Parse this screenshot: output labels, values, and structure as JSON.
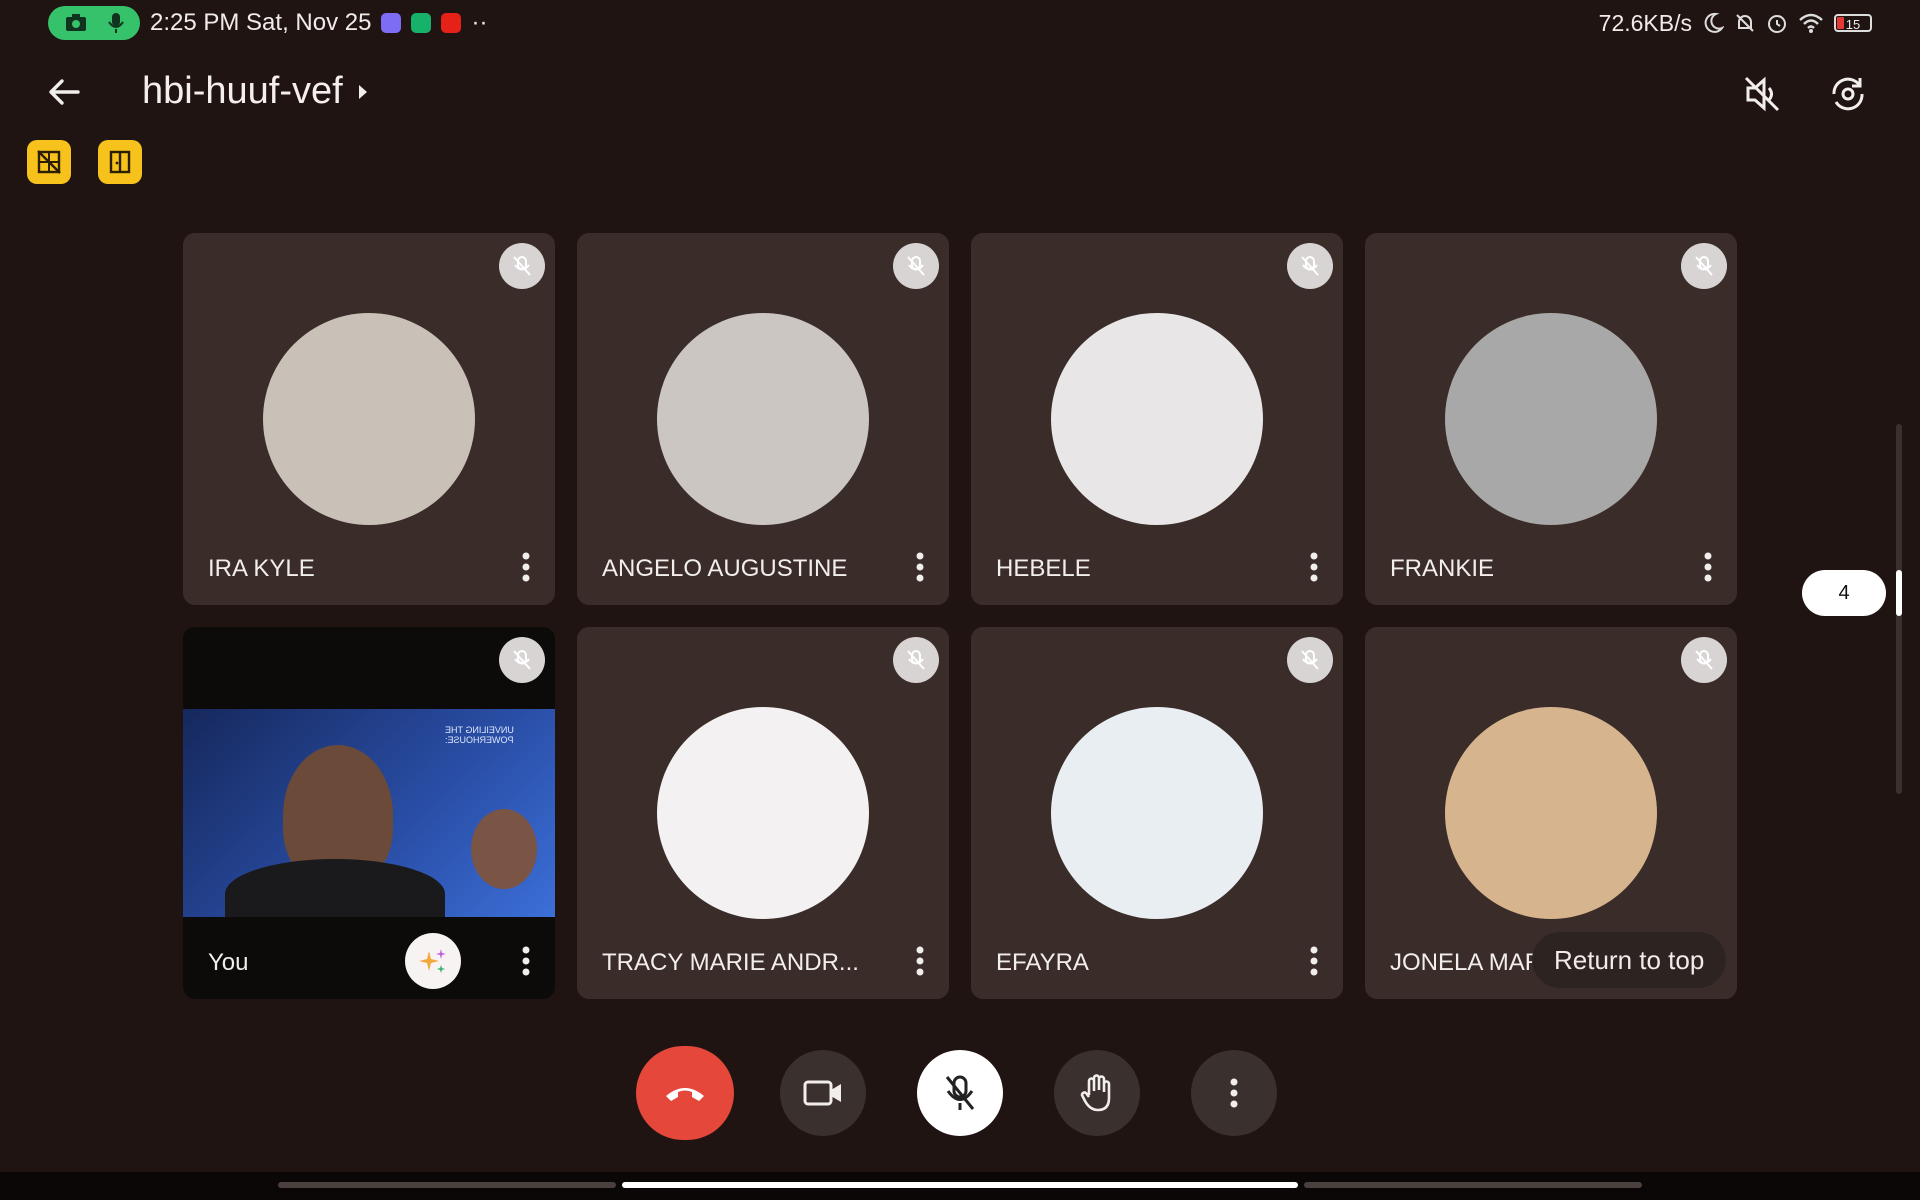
{
  "status_bar": {
    "time_date": "2:25 PM Sat, Nov 25",
    "more": "··",
    "net_speed": "72.6KB/s",
    "battery": "15"
  },
  "header": {
    "title": "hbi-huuf-vef"
  },
  "tiles": [
    {
      "name": "IRA KYLE",
      "avatar_color": "#c9c0b8"
    },
    {
      "name": "ANGELO AUGUSTINE",
      "avatar_color": "#cbc6c2"
    },
    {
      "name": "HEBELE",
      "avatar_color": "#e8e6e6"
    },
    {
      "name": "FRANKIE",
      "avatar_color": "#a8a8a8"
    },
    {
      "name": "You",
      "avatar_color": "#2a4fa8"
    },
    {
      "name": "TRACY MARIE ANDR...",
      "avatar_color": "#f3f1f1"
    },
    {
      "name": "EFAYRA",
      "avatar_color": "#e9eef3"
    },
    {
      "name": "JONELA MARI",
      "avatar_color": "#d6b48e"
    }
  ],
  "you_video": {
    "bg_text": "UNVEILING THE POWERHOUSE:"
  },
  "overlay": {
    "return_to_top": "Return to top",
    "page_number": "4"
  },
  "colors": {
    "background": "#1f1412",
    "tile": "#3a2c29",
    "hangup": "#e5473b",
    "badge": "#f6c21b"
  }
}
